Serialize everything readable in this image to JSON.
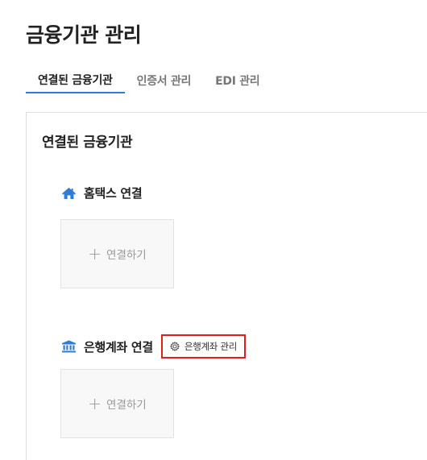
{
  "page": {
    "title": "금융기관 관리"
  },
  "tabs": [
    {
      "label": "연결된 금융기관",
      "active": true
    },
    {
      "label": "인증서 관리",
      "active": false
    },
    {
      "label": "EDI 관리",
      "active": false
    }
  ],
  "panel": {
    "title": "연결된 금융기관",
    "hometax": {
      "icon": "home-icon",
      "label": "홈택스 연결",
      "connect_label": "연결하기"
    },
    "bank": {
      "icon": "bank-icon",
      "label": "은행계좌 연결",
      "manage_label": "은행계좌 관리",
      "manage_icon": "gear-icon",
      "connect_label": "연결하기"
    }
  },
  "colors": {
    "accent": "#2f7bd6",
    "highlight_border": "#e01e1e",
    "icon_blue": "#2f7bd6"
  }
}
